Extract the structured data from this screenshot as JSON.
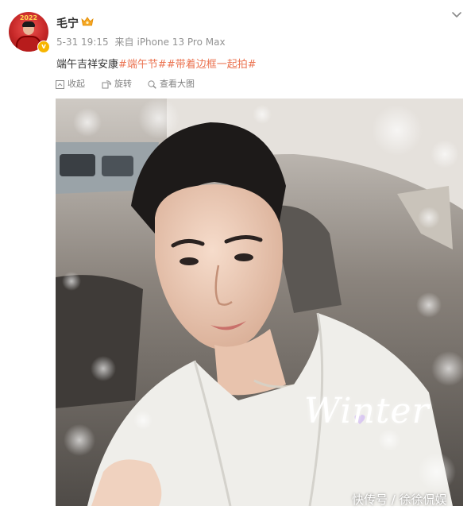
{
  "post": {
    "author": "毛宁",
    "avatar_year": "2022",
    "verified_badge": "v",
    "icons": {
      "badge": "crown-icon",
      "menu": "chevron-down-icon",
      "collect": "collect-icon",
      "rotate": "rotate-icon",
      "view_large": "view-large-icon"
    },
    "time": "5-31 19:15",
    "source_prefix": "来自",
    "source": "iPhone 13 Pro Max",
    "text_plain": "端午吉祥安康",
    "tags": [
      "#端午节#",
      "#带着边框一起拍#"
    ],
    "toolbar": {
      "collect": "收起",
      "rotate": "旋转",
      "view_large": "查看大图"
    },
    "photo_overlay_text": "Winter",
    "watermark": "快传号 / 徐徐侃娱"
  },
  "colors": {
    "link": "#eb7350",
    "meta": "#939393",
    "toolbar_text": "#808080",
    "verified": "#f7b500"
  }
}
